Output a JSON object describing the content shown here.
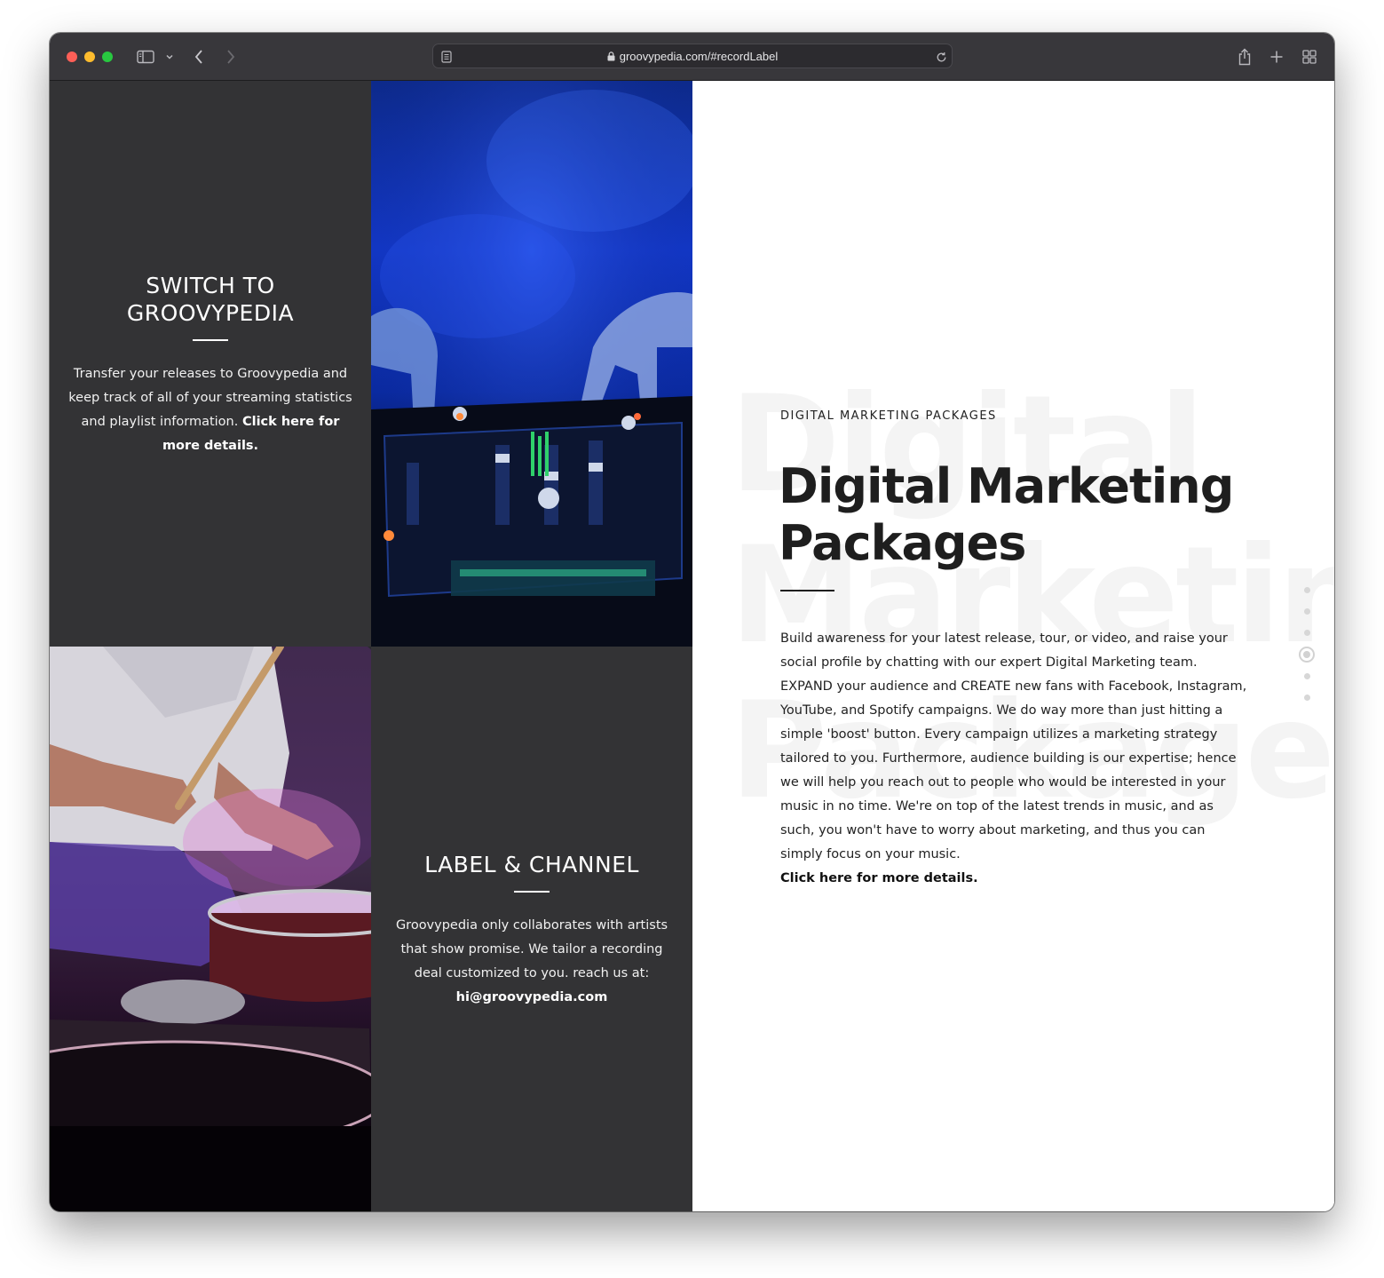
{
  "browser": {
    "url": "groovypedia.com/#recordLabel",
    "icons": [
      "sidebar-icon",
      "chevron-down-icon",
      "back-icon",
      "forward-icon",
      "reader-icon",
      "lock-icon",
      "reload-icon",
      "share-icon",
      "new-tab-icon",
      "tab-overview-icon"
    ]
  },
  "switch_panel": {
    "title_line1": "SWITCH TO",
    "title_line2": "GROOVYPEDIA",
    "text": "Transfer your releases to Groovypedia and keep track of all of your streaming statistics and playlist information.",
    "link": "Click here for more details."
  },
  "label_panel": {
    "title": "LABEL & CHANNEL",
    "text": "Groovypedia only collaborates with artists that show promise. We tailor a recording deal customized to you. reach us at:",
    "email": "hi@groovypedia.com"
  },
  "marketing": {
    "ghost_line1": "Digital",
    "ghost_line2": "Marketing",
    "ghost_line3": "Packages",
    "kicker": "DIGITAL MARKETING PACKAGES",
    "heading_line1": "Digital Marketing",
    "heading_line2": "Packages",
    "body": "Build awareness for your latest release, tour, or video, and raise your social profile by chatting with our expert Digital Marketing team. EXPAND your audience and CREATE new fans with Facebook, Instagram, YouTube, and Spotify campaigns. We do way more than just hitting a simple 'boost' button. Every campaign utilizes a marketing strategy tailored to you. Furthermore, audience building is our expertise; hence we will help you reach out to people who would be interested in your music in no time. We're on top of the latest trends in music, and as such, you won't have to worry about marketing, and thus you can simply focus on your music.",
    "link": "Click here for more details."
  },
  "pagination": {
    "total": 6,
    "active_index": 3
  },
  "colors": {
    "toolbar": "#38373b",
    "dark_panel": "#333335",
    "accent_text": "#1e1e1e"
  }
}
